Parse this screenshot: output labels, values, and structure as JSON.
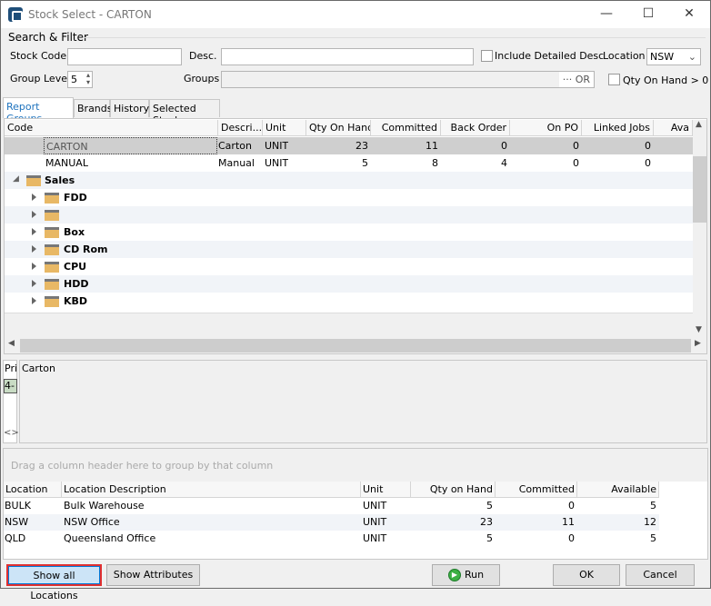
{
  "window": {
    "title": "Stock Select - CARTON",
    "minimize": "—",
    "maximize": "☐",
    "close": "✕"
  },
  "filter": {
    "section": "Search & Filter",
    "stock_code_label": "Stock Code",
    "stock_code_value": "",
    "desc_label": "Desc.",
    "desc_value": "",
    "include_detailed_desc": "Include Detailed Desc",
    "include_detailed_checked": false,
    "location_label": "Location",
    "location_value": "NSW",
    "group_level_label": "Group Level",
    "group_level_value": "5",
    "groups_label": "Groups",
    "groups_value": "",
    "groups_button": "··· OR",
    "qty_on_hand_filter": "Qty On Hand > 0",
    "qty_on_hand_checked": false
  },
  "tabs": [
    {
      "label": "Report Groups",
      "active": true
    },
    {
      "label": "Brands"
    },
    {
      "label": "History"
    },
    {
      "label": "Selected Stock"
    }
  ],
  "grid": {
    "columns": [
      "Code",
      "Descri...",
      "Unit",
      "Qty On Hand",
      "Committed",
      "Back Order",
      "On PO",
      "Linked Jobs",
      "Ava"
    ],
    "items": [
      {
        "code": "CARTON",
        "desc": "Carton",
        "unit": "UNIT",
        "qty": "23",
        "committed": "11",
        "back_order": "0",
        "on_po": "0",
        "linked_jobs": "0",
        "selected": true
      },
      {
        "code": "MANUAL",
        "desc": "Manual",
        "unit": "UNIT",
        "qty": "5",
        "committed": "8",
        "back_order": "4",
        "on_po": "0",
        "linked_jobs": "0"
      }
    ],
    "groups": [
      {
        "label": "Sales",
        "level": 0
      },
      {
        "label": "FDD",
        "level": 1
      },
      {
        "label": "",
        "level": 1
      },
      {
        "label": "Box",
        "level": 1
      },
      {
        "label": "CD Rom",
        "level": 1
      },
      {
        "label": "CPU",
        "level": 1
      },
      {
        "label": "HDD",
        "level": 1
      },
      {
        "label": "KBD",
        "level": 1
      }
    ]
  },
  "detail": {
    "side_header": "Pri",
    "side_value": "4-F",
    "memo": "Carton"
  },
  "locations": {
    "group_hint": "Drag a column header here to group by that column",
    "columns": [
      "Location",
      "Location Description",
      "Unit",
      "Qty on Hand",
      "Committed",
      "Available"
    ],
    "rows": [
      [
        "BULK",
        "Bulk Warehouse",
        "UNIT",
        "5",
        "0",
        "5"
      ],
      [
        "NSW",
        "NSW Office",
        "UNIT",
        "23",
        "11",
        "12"
      ],
      [
        "QLD",
        "Queensland Office",
        "UNIT",
        "5",
        "0",
        "5"
      ]
    ]
  },
  "buttons": {
    "show_all_locations": "Show all Locations",
    "show_attributes": "Show Attributes",
    "run": "Run",
    "ok": "OK",
    "cancel": "Cancel"
  },
  "colors": {
    "accent": "#1e73be",
    "selected_row": "#cfcfcf",
    "folder": "#e8b865",
    "run_icon": "#3cb043"
  }
}
